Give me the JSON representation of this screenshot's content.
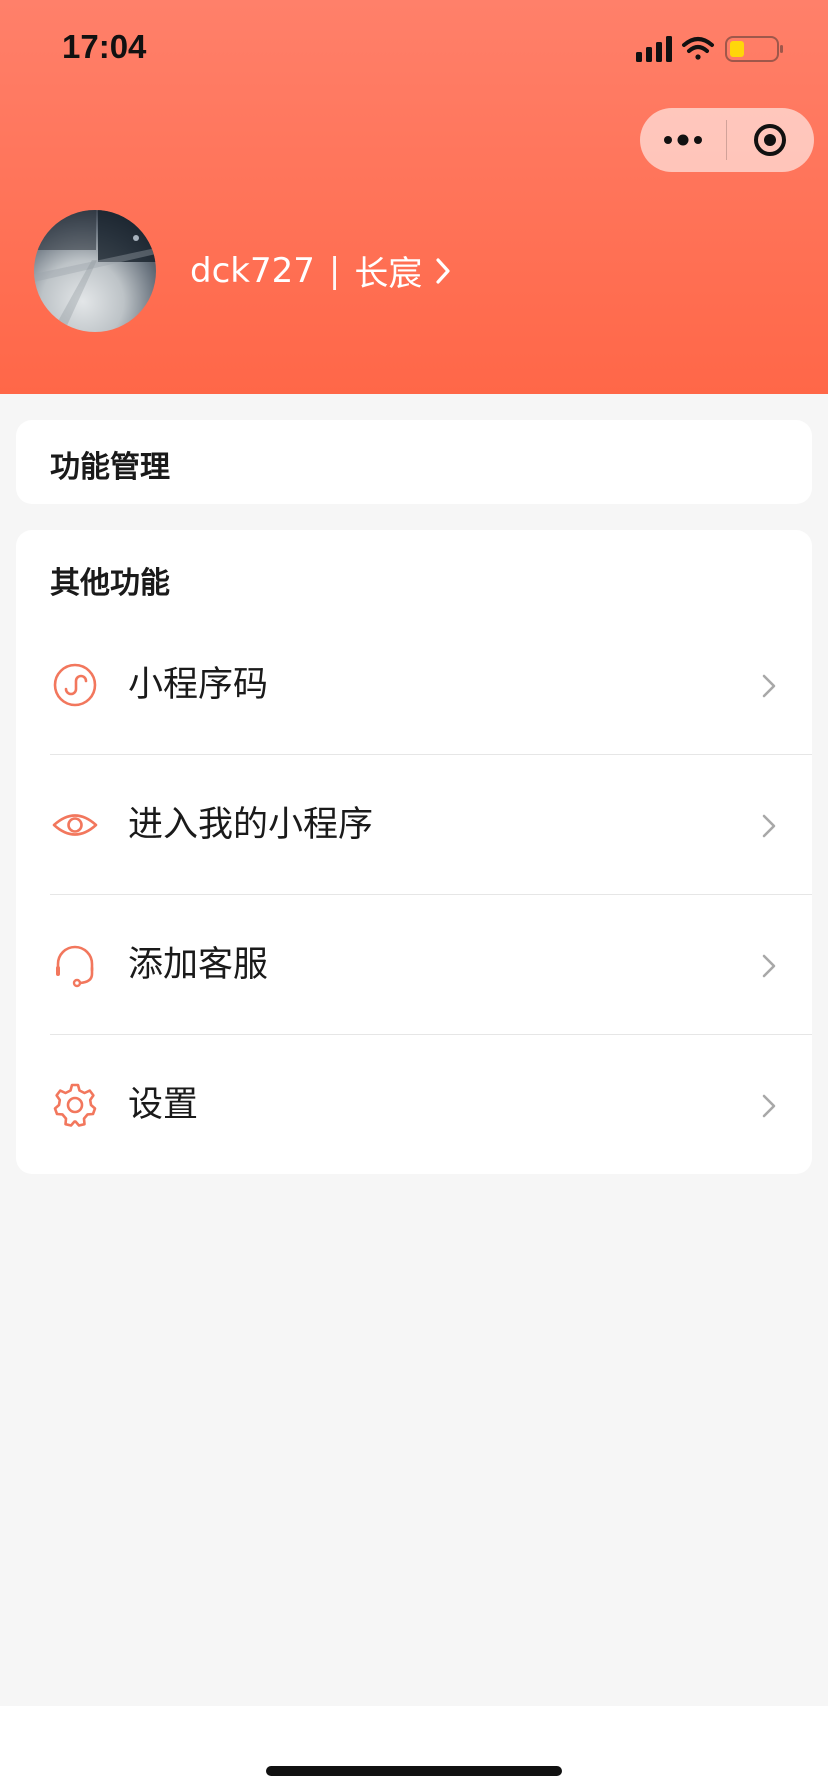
{
  "status_bar": {
    "time": "17:04"
  },
  "profile": {
    "username": "dck727",
    "separator": "|",
    "nickname": "长宸"
  },
  "cards": {
    "function_management": {
      "title": "功能管理"
    },
    "other_functions": {
      "title": "其他功能",
      "items": [
        {
          "label": "小程序码",
          "icon": "mini-program-icon"
        },
        {
          "label": "进入我的小程序",
          "icon": "eye-icon"
        },
        {
          "label": "添加客服",
          "icon": "headset-icon"
        },
        {
          "label": "设置",
          "icon": "gear-icon"
        }
      ]
    }
  },
  "colors": {
    "accent": "#f2775d",
    "header_top": "#ff806a",
    "header_bottom": "#ff6748",
    "background": "#f6f6f6"
  }
}
